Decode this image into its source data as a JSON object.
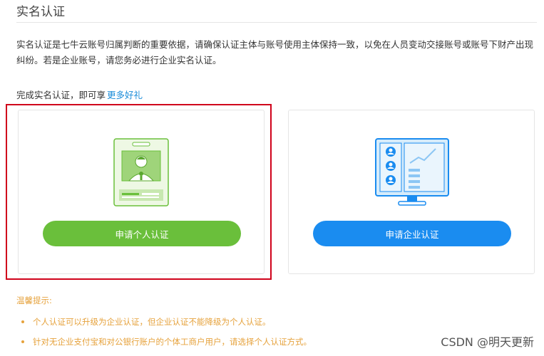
{
  "header": {
    "title": "实名认证"
  },
  "intro": {
    "description": "实名认证是七牛云账号归属判断的重要依据，请确保认证主体与账号使用主体保持一致，以免在人员变动交接账号或账号下财产出现纠纷。若是企业账号，请您务必进行企业实名认证。",
    "promo_text": "完成实名认证，即可享",
    "promo_link": "更多好礼"
  },
  "options": {
    "personal": {
      "button_label": "申请个人认证",
      "icon": "personal-id-card-icon"
    },
    "enterprise": {
      "button_label": "申请企业认证",
      "icon": "enterprise-monitor-icon"
    }
  },
  "tips": {
    "title": "温馨提示:",
    "items": [
      "个人认证可以升级为企业认证，但企业认证不能降级为个人认证。",
      "针对无企业支付宝和对公银行账户的个体工商户用户，请选择个人认证方式。"
    ]
  },
  "watermark": "CSDN @明天更新",
  "colors": {
    "accent_green": "#6abf3b",
    "accent_blue": "#1a8cf0",
    "link_blue": "#1a8cd8",
    "tip_orange": "#e6a23c",
    "highlight_red": "#d0021b"
  }
}
